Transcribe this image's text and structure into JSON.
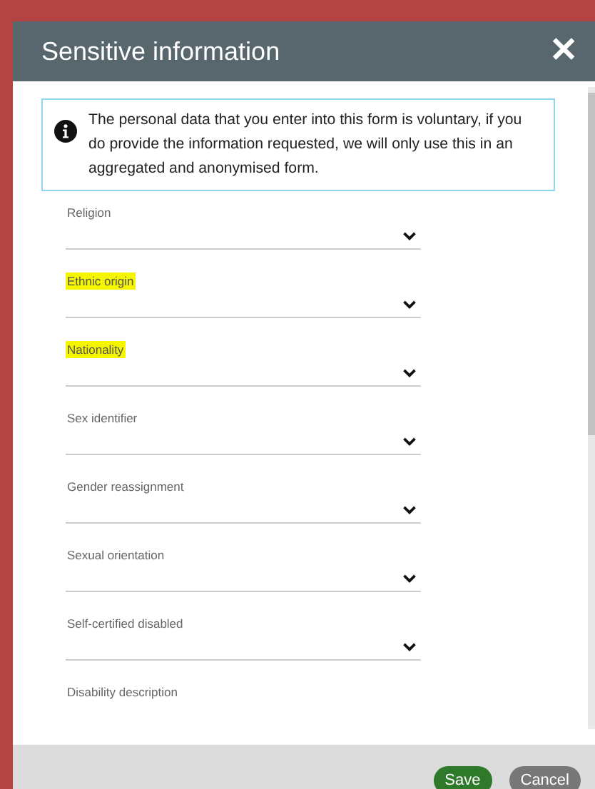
{
  "dialog": {
    "title": "Sensitive information",
    "close": "✕"
  },
  "notice": "The personal data that you enter into this form is voluntary, if you do provide the information requested, we will only use this in an aggregated and anonymised form.",
  "fields": [
    {
      "label": "Religion",
      "kind": "select",
      "highlighted": false
    },
    {
      "label": "Ethnic origin",
      "kind": "select",
      "highlighted": true
    },
    {
      "label": "Nationality",
      "kind": "select",
      "highlighted": true
    },
    {
      "label": "Sex identifier",
      "kind": "select",
      "highlighted": false
    },
    {
      "label": "Gender reassignment",
      "kind": "select",
      "highlighted": false
    },
    {
      "label": "Sexual orientation",
      "kind": "select",
      "highlighted": false
    },
    {
      "label": "Self-certified disabled",
      "kind": "select",
      "highlighted": false
    },
    {
      "label": "Disability description",
      "kind": "text",
      "highlighted": false
    }
  ],
  "buttons": [
    {
      "label": "Save",
      "kind": "primary"
    },
    {
      "label": "Cancel",
      "kind": "secondary"
    }
  ]
}
